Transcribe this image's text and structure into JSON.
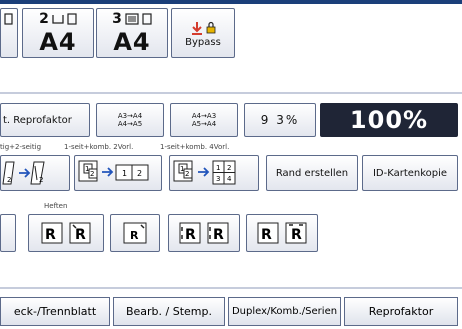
{
  "paper": {
    "tray1": {
      "num": "",
      "size": ""
    },
    "tray2": {
      "num": "2",
      "size": "A4"
    },
    "tray3": {
      "num": "3",
      "size": "A4"
    },
    "bypass": {
      "label": "Bypass"
    }
  },
  "reduce": {
    "auto_reprofaktor": "t. Reprofaktor",
    "a3_a4": "A3→A4",
    "a4_a5": "A4→A5",
    "a4_a3": "A4→A3",
    "a5_a4": "A5→A4",
    "zoom93": "9 3%",
    "zoom100": "100%"
  },
  "duplex_labels": {
    "two_sided": "tig+2-seitig",
    "comb2": "1-seit+komb. 2Vorl.",
    "comb4": "1-seit+komb. 4Vorl."
  },
  "duplex_buttons": {
    "rand_erstellen": "Rand erstellen",
    "id_karten": "ID-Kartenkopie"
  },
  "staple": {
    "label": "Heften"
  },
  "bottom_tabs": {
    "deck": "eck-/Trennblatt",
    "bearb": "Bearb. / Stemp.",
    "duplex": "Duplex/Komb./Serien",
    "reprofaktor": "Reprofaktor"
  },
  "colors": {
    "accent_red": "#d43c2e",
    "dark_button": "#1f2536",
    "border": "#5c6a8a"
  }
}
